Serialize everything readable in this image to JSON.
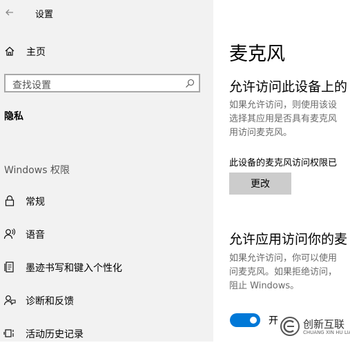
{
  "window": {
    "title": "设置"
  },
  "sidebar": {
    "home_label": "主页",
    "search_placeholder": "查找设置",
    "section_title": "隐私",
    "group_title": "Windows 权限",
    "items": [
      {
        "label": "常规",
        "icon": "lock-icon"
      },
      {
        "label": "语音",
        "icon": "speech-icon"
      },
      {
        "label": "墨迹书写和键入个性化",
        "icon": "ink-icon"
      },
      {
        "label": "诊断和反馈",
        "icon": "feedback-icon"
      },
      {
        "label": "活动历史记录",
        "icon": "history-icon"
      }
    ]
  },
  "main": {
    "title": "麦克风",
    "section1": {
      "heading": "允许访问此设备上的",
      "desc": "如果允许访问，则使用该设\n选择其应用是否具有麦克风\n用访问麦克风。",
      "status": "此设备的麦克风访问权限已",
      "button": "更改"
    },
    "section2": {
      "heading": "允许应用访问你的麦",
      "desc": "如果允许访问，你可以使用\n问麦克风。如果拒绝访问，\n阻止 Windows。",
      "toggle_label": "开",
      "toggle_on": true
    }
  },
  "watermark": {
    "name": "创新互联",
    "sub": "CHUANG XIN HU LIAN"
  },
  "colors": {
    "accent": "#0078d7",
    "sidebar_bg": "#f2f2f2",
    "button_bg": "#cccccc"
  }
}
